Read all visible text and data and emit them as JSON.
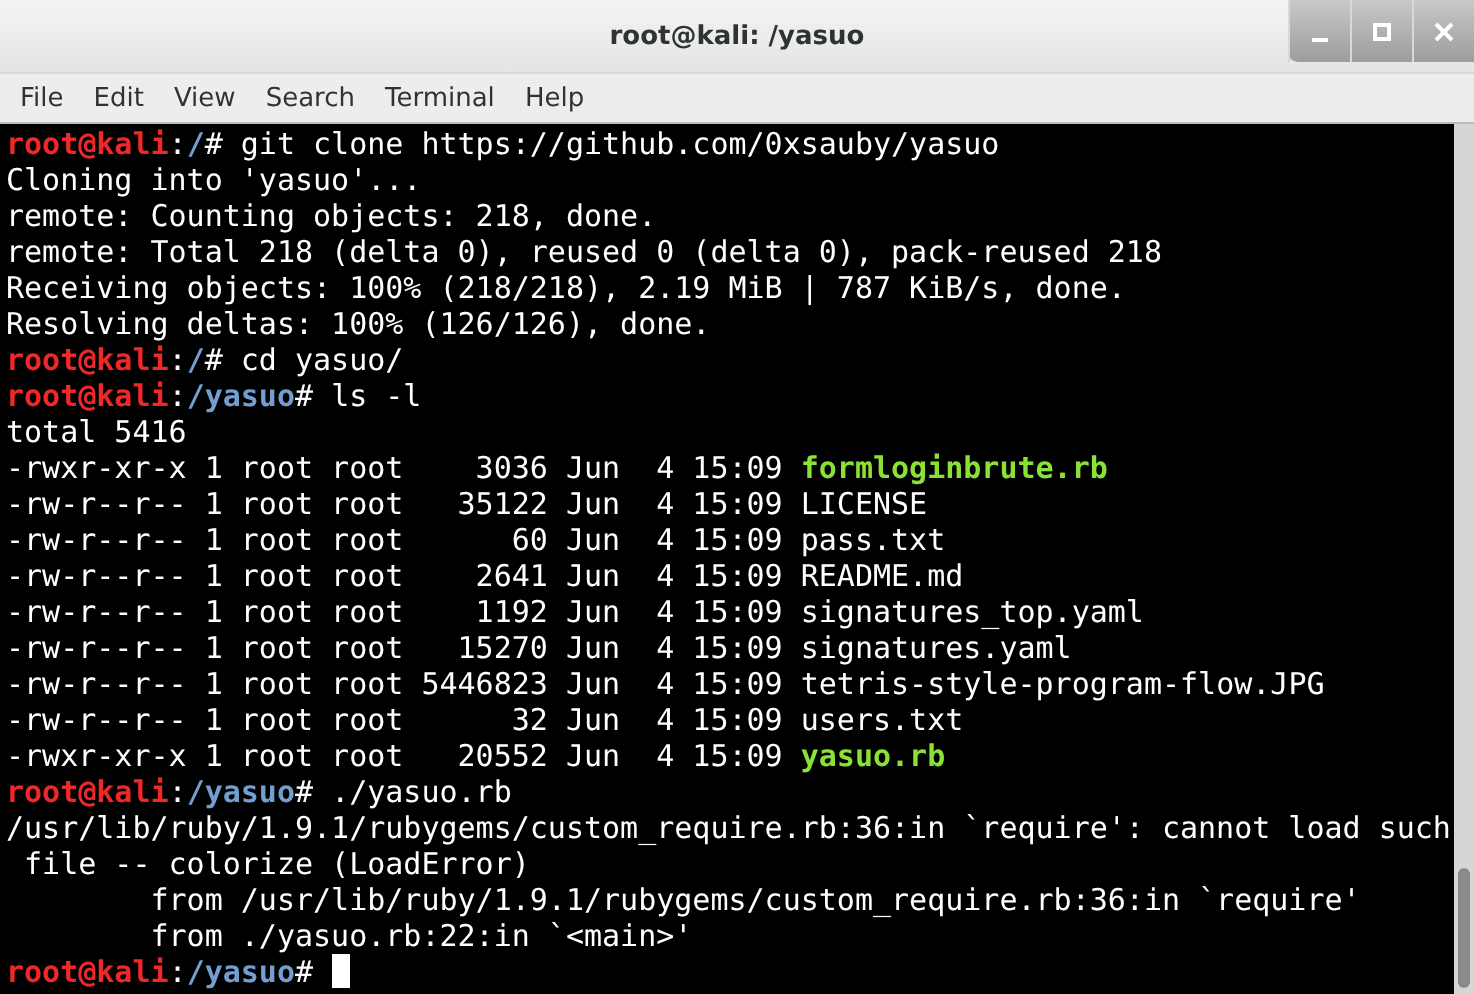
{
  "window": {
    "title": "root@kali: /yasuo"
  },
  "menu": [
    "File",
    "Edit",
    "View",
    "Search",
    "Terminal",
    "Help"
  ],
  "lines": [
    {
      "kind": "prompt",
      "user_host": "root@kali",
      "separator": ":",
      "path": "/",
      "symbol": "#",
      "command": "git clone https://github.com/0xsauby/yasuo"
    },
    {
      "kind": "output",
      "text": "Cloning into 'yasuo'..."
    },
    {
      "kind": "output",
      "text": "remote: Counting objects: 218, done."
    },
    {
      "kind": "output",
      "text": "remote: Total 218 (delta 0), reused 0 (delta 0), pack-reused 218"
    },
    {
      "kind": "output",
      "text": "Receiving objects: 100% (218/218), 2.19 MiB | 787 KiB/s, done."
    },
    {
      "kind": "output",
      "text": "Resolving deltas: 100% (126/126), done."
    },
    {
      "kind": "prompt",
      "user_host": "root@kali",
      "separator": ":",
      "path": "/",
      "symbol": "#",
      "command": "cd yasuo/"
    },
    {
      "kind": "prompt",
      "user_host": "root@kali",
      "separator": ":",
      "path": "/yasuo",
      "symbol": "#",
      "command": "ls -l"
    },
    {
      "kind": "output",
      "text": "total 5416"
    },
    {
      "kind": "entry",
      "info": "-rwxr-xr-x 1 root root    3036 Jun  4 15:09",
      "name": "formloginbrute.rb",
      "executable": true
    },
    {
      "kind": "entry",
      "info": "-rw-r--r-- 1 root root   35122 Jun  4 15:09",
      "name": "LICENSE",
      "executable": false
    },
    {
      "kind": "entry",
      "info": "-rw-r--r-- 1 root root      60 Jun  4 15:09",
      "name": "pass.txt",
      "executable": false
    },
    {
      "kind": "entry",
      "info": "-rw-r--r-- 1 root root    2641 Jun  4 15:09",
      "name": "README.md",
      "executable": false
    },
    {
      "kind": "entry",
      "info": "-rw-r--r-- 1 root root    1192 Jun  4 15:09",
      "name": "signatures_top.yaml",
      "executable": false
    },
    {
      "kind": "entry",
      "info": "-rw-r--r-- 1 root root   15270 Jun  4 15:09",
      "name": "signatures.yaml",
      "executable": false
    },
    {
      "kind": "entry",
      "info": "-rw-r--r-- 1 root root 5446823 Jun  4 15:09",
      "name": "tetris-style-program-flow.JPG",
      "executable": false
    },
    {
      "kind": "entry",
      "info": "-rw-r--r-- 1 root root      32 Jun  4 15:09",
      "name": "users.txt",
      "executable": false
    },
    {
      "kind": "entry",
      "info": "-rwxr-xr-x 1 root root   20552 Jun  4 15:09",
      "name": "yasuo.rb",
      "executable": true
    },
    {
      "kind": "prompt",
      "user_host": "root@kali",
      "separator": ":",
      "path": "/yasuo",
      "symbol": "#",
      "command": "./yasuo.rb"
    },
    {
      "kind": "output",
      "text": "/usr/lib/ruby/1.9.1/rubygems/custom_require.rb:36:in `require': cannot load such"
    },
    {
      "kind": "output",
      "text": " file -- colorize (LoadError)"
    },
    {
      "kind": "output",
      "text": "        from /usr/lib/ruby/1.9.1/rubygems/custom_require.rb:36:in `require'"
    },
    {
      "kind": "output",
      "text": "        from ./yasuo.rb:22:in `<main>'"
    },
    {
      "kind": "prompt",
      "user_host": "root@kali",
      "separator": ":",
      "path": "/yasuo",
      "symbol": "#",
      "cursor": true
    }
  ]
}
